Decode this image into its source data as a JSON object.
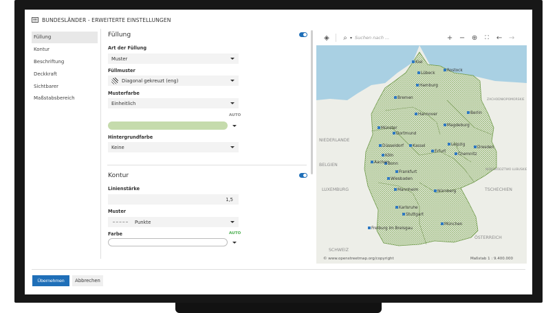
{
  "dialog": {
    "title": "BUNDESLÄNDER - ERWEITERTE EINSTELLUNGEN"
  },
  "sidebar": {
    "items": [
      {
        "label": "Füllung",
        "active": true
      },
      {
        "label": "Kontur",
        "active": false
      },
      {
        "label": "Beschriftung",
        "active": false
      },
      {
        "label": "Deckkraft",
        "active": false
      },
      {
        "label": "Sichtbarer Maßstabsbereich",
        "active": false
      }
    ]
  },
  "fill": {
    "section_title": "Füllung",
    "enabled": true,
    "type_label": "Art der Füllung",
    "type_value": "Muster",
    "pattern_label": "Füllmuster",
    "pattern_value": "Diagonal gekreuzt (eng)",
    "pattern_color_label": "Musterfarbe",
    "pattern_color_value": "Einheitlich",
    "auto_label": "AUTO",
    "pattern_color_swatch": "#c5dbac",
    "background_label": "Hintergrundfarbe",
    "background_value": "Keine"
  },
  "stroke": {
    "section_title": "Kontur",
    "enabled": true,
    "width_label": "Linienstärke",
    "width_value": "1,5",
    "pattern_label": "Muster",
    "pattern_value": "Punkte",
    "color_label": "Farbe",
    "auto_label": "AUTO",
    "color_swatch": "#ffffff"
  },
  "map": {
    "search_placeholder": "Suchen nach ...",
    "attribution": "© www.openstreetmap.org/copyright",
    "scale_text": "Maßstab 1 : 9.400.000",
    "region_labels": [
      "NIEDERLANDE",
      "BELGIEN",
      "LUXEMBURG",
      "TSCHECHIEN",
      "ÖSTERREICH",
      "SCHWEIZ",
      "ZACHODNIOPOMORSKIE",
      "WOJEWÓDZTWO LUBUSKIE"
    ],
    "city_labels": [
      "Kiel",
      "Lübeck",
      "Rostock",
      "Hamburg",
      "Bremen",
      "Hannover",
      "Berlin",
      "Magdeburg",
      "Münster",
      "Dortmund",
      "Düsseldorf",
      "Köln",
      "Bonn",
      "Aachen",
      "Kassel",
      "Erfurt",
      "Leipzig",
      "Dresden",
      "Chemnitz",
      "Frankfurt",
      "Wiesbaden",
      "Mannheim",
      "Nürnberg",
      "Karlsruhe",
      "Stuttgart",
      "München",
      "Freiburg im Breisgau"
    ]
  },
  "footer": {
    "apply_label": "Übernehmen",
    "cancel_label": "Abbrechen"
  },
  "colors": {
    "accent": "#1f6fb8",
    "land_fill": "#c5dbac",
    "water": "#a9d0e3",
    "marker": "#2e78c2"
  }
}
